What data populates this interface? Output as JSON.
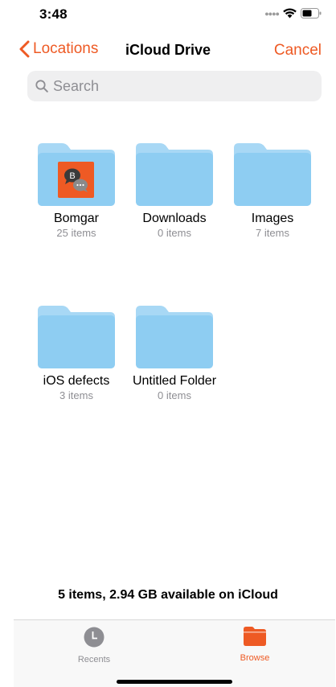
{
  "status_bar": {
    "time": "3:48"
  },
  "nav": {
    "back_label": "Locations",
    "title": "iCloud Drive",
    "cancel_label": "Cancel",
    "accent_color": "#EE5A24"
  },
  "search": {
    "placeholder": "Search"
  },
  "folders": [
    {
      "name": "Bomgar",
      "count": "25 items",
      "icon": "folder-with-bomgar-app-icon"
    },
    {
      "name": "Downloads",
      "count": "0 items",
      "icon": "folder-icon"
    },
    {
      "name": "Images",
      "count": "7 items",
      "icon": "folder-icon"
    },
    {
      "name": "iOS defects",
      "count": "3 items",
      "icon": "folder-icon"
    },
    {
      "name": "Untitled Folder",
      "count": "0 items",
      "icon": "folder-icon"
    }
  ],
  "bomgar_badge_letter": "B",
  "storage_info": "5 items, 2.94 GB available on iCloud",
  "tabs": [
    {
      "label": "Recents",
      "icon": "clock-icon",
      "active": false
    },
    {
      "label": "Browse",
      "icon": "folder-icon",
      "active": true
    }
  ],
  "colors": {
    "folder_light": "#A8D8F5",
    "folder_dark": "#8ECDF2",
    "inactive_tab": "#8E8E93"
  }
}
